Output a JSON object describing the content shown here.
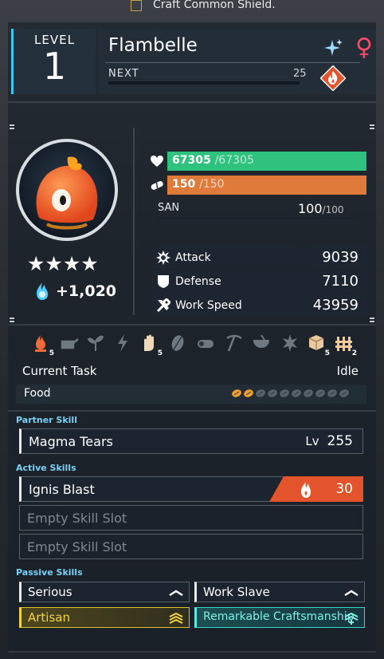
{
  "banner": {
    "craft_label": "Craft Common Shield."
  },
  "level": {
    "label": "LEVEL",
    "value": "1"
  },
  "pal": {
    "name": "Flambelle",
    "next_label": "NEXT",
    "next_value": "25",
    "next_progress": 0,
    "gender": "♀",
    "element": "fire",
    "sparkle_icon": "sparkle-icon",
    "colors": {
      "accent": "#3ec6f0",
      "gender": "#ff4a6a",
      "fire": "#e3532c"
    }
  },
  "rank": {
    "stars": "★★★★",
    "star_count": 4,
    "soul_value": "+1,020"
  },
  "vitals": {
    "hp": {
      "current": "67305",
      "max": "/67305",
      "fraction": 1.0,
      "color": "#2ec27e"
    },
    "sp": {
      "current": "150",
      "max": "/150",
      "fraction": 1.0,
      "color": "#e07a3a"
    },
    "san": {
      "label": "SAN",
      "current": "100",
      "max": "/100"
    }
  },
  "stats": [
    {
      "label": "Attack",
      "value": "9039",
      "icon": "attack-icon"
    },
    {
      "label": "Defense",
      "value": "7110",
      "icon": "defense-icon"
    },
    {
      "label": "Work Speed",
      "value": "43959",
      "icon": "work-speed-icon"
    }
  ],
  "work_suitability": [
    {
      "name": "kindling",
      "level": "5",
      "active": true
    },
    {
      "name": "watering",
      "level": "",
      "active": false
    },
    {
      "name": "planting",
      "level": "",
      "active": false
    },
    {
      "name": "generating-electricity",
      "level": "",
      "active": false
    },
    {
      "name": "handiwork",
      "level": "5",
      "active": true
    },
    {
      "name": "gathering",
      "level": "",
      "active": false
    },
    {
      "name": "lumbering",
      "level": "",
      "active": false
    },
    {
      "name": "mining",
      "level": "",
      "active": false
    },
    {
      "name": "medicine",
      "level": "",
      "active": false
    },
    {
      "name": "cooling",
      "level": "",
      "active": false
    },
    {
      "name": "transporting",
      "level": "5",
      "active": true
    },
    {
      "name": "farming",
      "level": "2",
      "active": true
    }
  ],
  "task": {
    "label": "Current Task",
    "value": "Idle"
  },
  "food": {
    "label": "Food",
    "filled": 2,
    "total": 10
  },
  "partner_skill": {
    "section_label": "Partner Skill",
    "name": "Magma Tears",
    "level_label": "Lv",
    "level": "255"
  },
  "active_skills": {
    "section_label": "Active Skills",
    "slots": [
      {
        "name": "Ignis Blast",
        "power": "30",
        "element": "fire"
      },
      {
        "name": "Empty Skill Slot"
      },
      {
        "name": "Empty Skill Slot"
      }
    ]
  },
  "passive_skills": {
    "section_label": "Passive Skills",
    "items": [
      {
        "name": "Serious",
        "tier": "normal"
      },
      {
        "name": "Work Slave",
        "tier": "normal"
      },
      {
        "name": "Artisan",
        "tier": "gold"
      },
      {
        "name": "Remarkable Craftsmanship",
        "tier": "legendary"
      }
    ]
  }
}
